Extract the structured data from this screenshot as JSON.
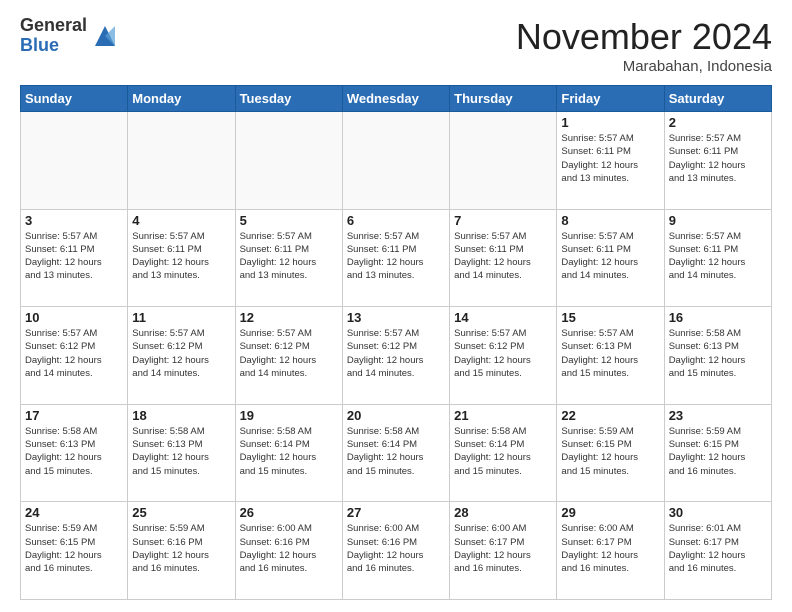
{
  "header": {
    "logo_general": "General",
    "logo_blue": "Blue",
    "month_title": "November 2024",
    "location": "Marabahan, Indonesia"
  },
  "weekdays": [
    "Sunday",
    "Monday",
    "Tuesday",
    "Wednesday",
    "Thursday",
    "Friday",
    "Saturday"
  ],
  "weeks": [
    [
      {
        "day": "",
        "info": ""
      },
      {
        "day": "",
        "info": ""
      },
      {
        "day": "",
        "info": ""
      },
      {
        "day": "",
        "info": ""
      },
      {
        "day": "",
        "info": ""
      },
      {
        "day": "1",
        "info": "Sunrise: 5:57 AM\nSunset: 6:11 PM\nDaylight: 12 hours\nand 13 minutes."
      },
      {
        "day": "2",
        "info": "Sunrise: 5:57 AM\nSunset: 6:11 PM\nDaylight: 12 hours\nand 13 minutes."
      }
    ],
    [
      {
        "day": "3",
        "info": "Sunrise: 5:57 AM\nSunset: 6:11 PM\nDaylight: 12 hours\nand 13 minutes."
      },
      {
        "day": "4",
        "info": "Sunrise: 5:57 AM\nSunset: 6:11 PM\nDaylight: 12 hours\nand 13 minutes."
      },
      {
        "day": "5",
        "info": "Sunrise: 5:57 AM\nSunset: 6:11 PM\nDaylight: 12 hours\nand 13 minutes."
      },
      {
        "day": "6",
        "info": "Sunrise: 5:57 AM\nSunset: 6:11 PM\nDaylight: 12 hours\nand 13 minutes."
      },
      {
        "day": "7",
        "info": "Sunrise: 5:57 AM\nSunset: 6:11 PM\nDaylight: 12 hours\nand 14 minutes."
      },
      {
        "day": "8",
        "info": "Sunrise: 5:57 AM\nSunset: 6:11 PM\nDaylight: 12 hours\nand 14 minutes."
      },
      {
        "day": "9",
        "info": "Sunrise: 5:57 AM\nSunset: 6:11 PM\nDaylight: 12 hours\nand 14 minutes."
      }
    ],
    [
      {
        "day": "10",
        "info": "Sunrise: 5:57 AM\nSunset: 6:12 PM\nDaylight: 12 hours\nand 14 minutes."
      },
      {
        "day": "11",
        "info": "Sunrise: 5:57 AM\nSunset: 6:12 PM\nDaylight: 12 hours\nand 14 minutes."
      },
      {
        "day": "12",
        "info": "Sunrise: 5:57 AM\nSunset: 6:12 PM\nDaylight: 12 hours\nand 14 minutes."
      },
      {
        "day": "13",
        "info": "Sunrise: 5:57 AM\nSunset: 6:12 PM\nDaylight: 12 hours\nand 14 minutes."
      },
      {
        "day": "14",
        "info": "Sunrise: 5:57 AM\nSunset: 6:12 PM\nDaylight: 12 hours\nand 15 minutes."
      },
      {
        "day": "15",
        "info": "Sunrise: 5:57 AM\nSunset: 6:13 PM\nDaylight: 12 hours\nand 15 minutes."
      },
      {
        "day": "16",
        "info": "Sunrise: 5:58 AM\nSunset: 6:13 PM\nDaylight: 12 hours\nand 15 minutes."
      }
    ],
    [
      {
        "day": "17",
        "info": "Sunrise: 5:58 AM\nSunset: 6:13 PM\nDaylight: 12 hours\nand 15 minutes."
      },
      {
        "day": "18",
        "info": "Sunrise: 5:58 AM\nSunset: 6:13 PM\nDaylight: 12 hours\nand 15 minutes."
      },
      {
        "day": "19",
        "info": "Sunrise: 5:58 AM\nSunset: 6:14 PM\nDaylight: 12 hours\nand 15 minutes."
      },
      {
        "day": "20",
        "info": "Sunrise: 5:58 AM\nSunset: 6:14 PM\nDaylight: 12 hours\nand 15 minutes."
      },
      {
        "day": "21",
        "info": "Sunrise: 5:58 AM\nSunset: 6:14 PM\nDaylight: 12 hours\nand 15 minutes."
      },
      {
        "day": "22",
        "info": "Sunrise: 5:59 AM\nSunset: 6:15 PM\nDaylight: 12 hours\nand 15 minutes."
      },
      {
        "day": "23",
        "info": "Sunrise: 5:59 AM\nSunset: 6:15 PM\nDaylight: 12 hours\nand 16 minutes."
      }
    ],
    [
      {
        "day": "24",
        "info": "Sunrise: 5:59 AM\nSunset: 6:15 PM\nDaylight: 12 hours\nand 16 minutes."
      },
      {
        "day": "25",
        "info": "Sunrise: 5:59 AM\nSunset: 6:16 PM\nDaylight: 12 hours\nand 16 minutes."
      },
      {
        "day": "26",
        "info": "Sunrise: 6:00 AM\nSunset: 6:16 PM\nDaylight: 12 hours\nand 16 minutes."
      },
      {
        "day": "27",
        "info": "Sunrise: 6:00 AM\nSunset: 6:16 PM\nDaylight: 12 hours\nand 16 minutes."
      },
      {
        "day": "28",
        "info": "Sunrise: 6:00 AM\nSunset: 6:17 PM\nDaylight: 12 hours\nand 16 minutes."
      },
      {
        "day": "29",
        "info": "Sunrise: 6:00 AM\nSunset: 6:17 PM\nDaylight: 12 hours\nand 16 minutes."
      },
      {
        "day": "30",
        "info": "Sunrise: 6:01 AM\nSunset: 6:17 PM\nDaylight: 12 hours\nand 16 minutes."
      }
    ]
  ]
}
